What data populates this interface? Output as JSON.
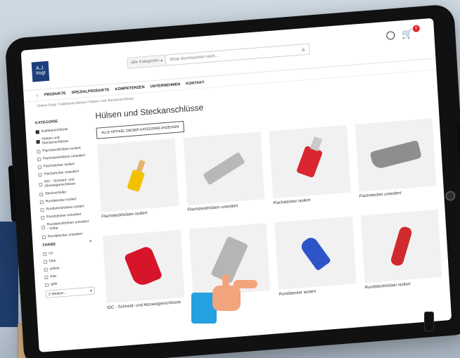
{
  "header": {
    "logo_text": "A.J.\nVogt",
    "search_category": "Alle Kategorien",
    "search_placeholder": "Shop durchsuchen nach...",
    "cart_count": "0"
  },
  "nav": {
    "items": [
      "PRODUKTE",
      "SPEZIALPRODUKTE",
      "KOMPETENZEN",
      "UNTERNEHMEN",
      "KONTAKT"
    ]
  },
  "breadcrumb": "Online-Shop / Kabelanschlüsse / Hülsen und Steckanschlüsse",
  "sidebar": {
    "category_title": "KATEGORIE",
    "categories": [
      {
        "label": "Kabelanschlüsse",
        "checked": true
      },
      {
        "label": "Hülsen und Steckanschlüsse",
        "checked": true
      },
      {
        "label": "Flachsteckhülsen isoliert",
        "checked": false
      },
      {
        "label": "Flachsteckhülsen unisoliert",
        "checked": false
      },
      {
        "label": "Flachstecker isoliert",
        "checked": false
      },
      {
        "label": "Flachstecker unisoliert",
        "checked": false
      },
      {
        "label": "IDC - Schneid- und Abzweiganschlüsse",
        "checked": false
      },
      {
        "label": "Steckverteiler",
        "checked": false
      },
      {
        "label": "Rundstecker isoliert",
        "checked": false
      },
      {
        "label": "Rundsteckhülsen isoliert",
        "checked": false
      },
      {
        "label": "Rundstecker unisoliert",
        "checked": false
      },
      {
        "label": "Rundsteckhülsen unisoliert - Vollar",
        "checked": false
      },
      {
        "label": "Rundstecker unisoliert",
        "checked": false
      }
    ],
    "color_title": "FARBE",
    "colors": [
      "rot",
      "blau",
      "yellow",
      "Klar",
      "gelb"
    ],
    "select_placeholder": "Z Weitere..."
  },
  "main": {
    "title": "Hülsen und Steckanschlüsse",
    "all_button": "ALLE ARTIKEL DIESER KATEGORIE ANZEIGEN",
    "products": [
      {
        "name": "Flachsteckhülsen isoliert"
      },
      {
        "name": "Flachsteckhülsen unisoliert"
      },
      {
        "name": "Flachstecker isoliert"
      },
      {
        "name": "Flachstecker unisoliert"
      },
      {
        "name": "IDC - Schneid- und Abzweiganschlüsse"
      },
      {
        "name": "Steckverteiler"
      },
      {
        "name": "Rundstecker isoliert"
      },
      {
        "name": "Rundsteckhülsen isoliert"
      }
    ]
  },
  "colors": {
    "brand": "#1c3f7c",
    "badge": "#e8202a",
    "accent_hand": "#25a0e0"
  }
}
